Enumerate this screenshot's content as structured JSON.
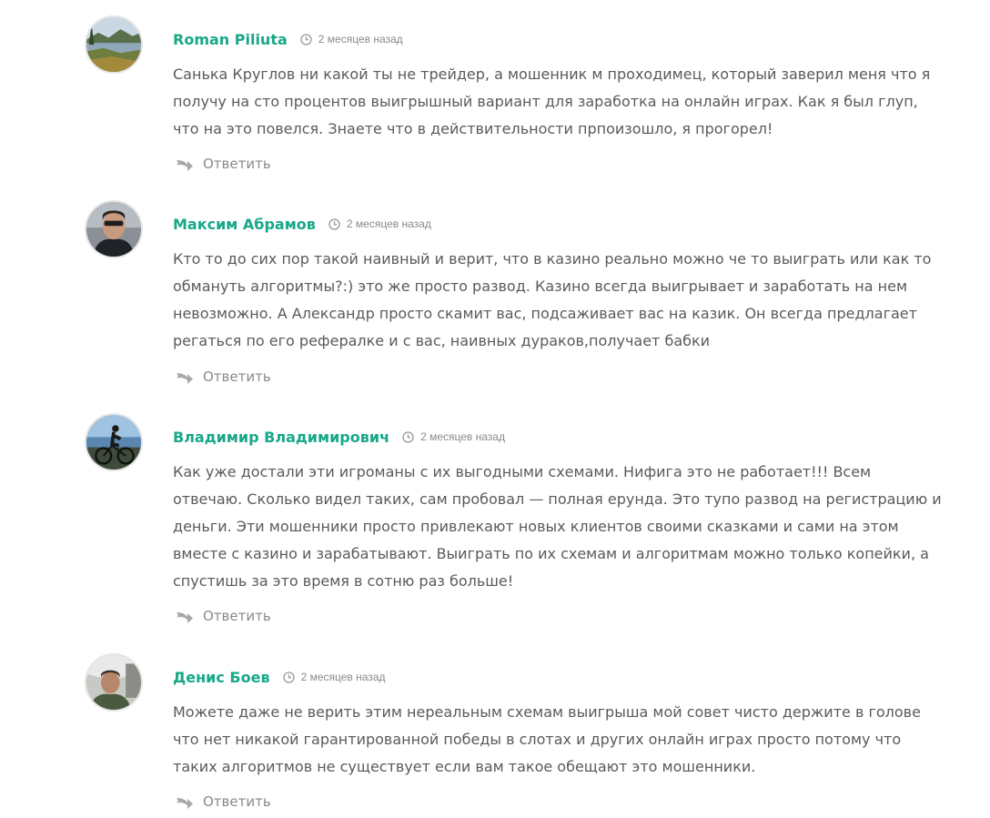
{
  "comments": [
    {
      "author": "Roman Piliuta",
      "time": "2 месяцев назад",
      "text": "Санька Круглов ни какой ты не трейдер, а мошенник м проходимец, который заверил меня что я получу на сто процентов выигрышный вариант для заработка на онлайн играх. Как я был глуп, что на это повелся. Знаете что в действительности прпоизошло, я прогорел!",
      "reply_label": "Ответить",
      "avatar_icon": "lake-landscape-photo"
    },
    {
      "author": "Максим Абрамов",
      "time": "2 месяцев назад",
      "text": "Кто то до сих пор такой наивный и верит, что в казино реально можно че то выиграть или как то обмануть алгоритмы?:) это же просто развод. Казино всегда выигрывает и заработать на нем невозможно. А Александр просто скамит вас, подсаживает вас на казик. Он всегда предлагает регаться по его рефералке и с вас, наивных дураков,получает бабки",
      "reply_label": "Ответить",
      "avatar_icon": "man-portrait-photo"
    },
    {
      "author": "Владимир Владимирович",
      "time": "2 месяцев назад",
      "text": "Как уже достали эти игроманы с их выгодными схемами. Нифига это не работает!!! Всем отвечаю. Сколько видел таких, сам пробовал — полная ерунда. Это тупо развод на регистрацию и деньги. Эти мошенники просто привлекают новых клиентов своими сказками и сами на этом вместе с казино и зарабатывают. Выиграть по их схемам и алгоритмам можно только копейки, а спустишь за это время в сотню раз больше!",
      "reply_label": "Ответить",
      "avatar_icon": "cyclist-photo"
    },
    {
      "author": "Денис Боев",
      "time": "2 месяцев назад",
      "text": "Можете даже не верить этим нереальным схемам выигрыша мой совет чисто держите в голове что нет никакой гарантированной победы в слотах и других онлайн играх просто потому что таких алгоритмов не существует если вам такое обещают это мошенники.",
      "reply_label": "Ответить",
      "avatar_icon": "man-in-car-photo"
    }
  ],
  "colors": {
    "author": "#18a888",
    "time": "#8a8a8a",
    "text": "#5a5a5a",
    "reply": "#8a8a8a"
  }
}
